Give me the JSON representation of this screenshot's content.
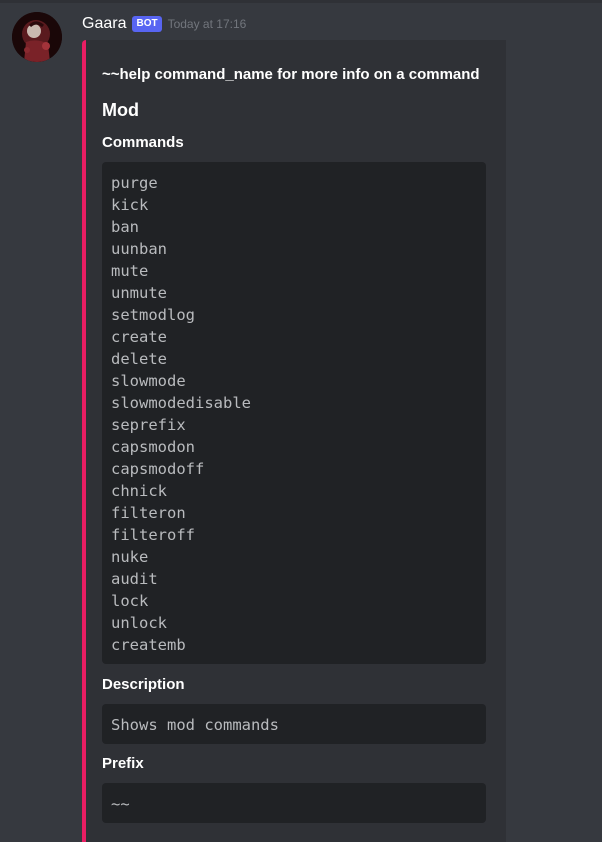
{
  "message": {
    "author": "Gaara",
    "badge": "BOT",
    "timestamp": "Today at 17:16"
  },
  "embed": {
    "accent_color": "#e91e63",
    "title": "~~help command_name for more info on a command",
    "subtitle": "Mod",
    "fields": [
      {
        "name": "Commands",
        "lines": [
          "purge",
          "kick",
          "ban",
          "uunban",
          "mute",
          "unmute",
          "setmodlog",
          "create",
          "delete",
          "slowmode",
          "slowmodedisable",
          "seprefix",
          "capsmodon",
          "capsmodoff",
          "chnick",
          "filteron",
          "filteroff",
          "nuke",
          "audit",
          "lock",
          "unlock",
          "createmb"
        ]
      },
      {
        "name": "Description",
        "value": "Shows mod commands"
      },
      {
        "name": "Prefix",
        "value": "~~"
      }
    ]
  },
  "colors": {
    "background": "#36393f",
    "embed_background": "#2f3136",
    "codeblock_background": "#202225",
    "bot_badge": "#5865f2"
  }
}
